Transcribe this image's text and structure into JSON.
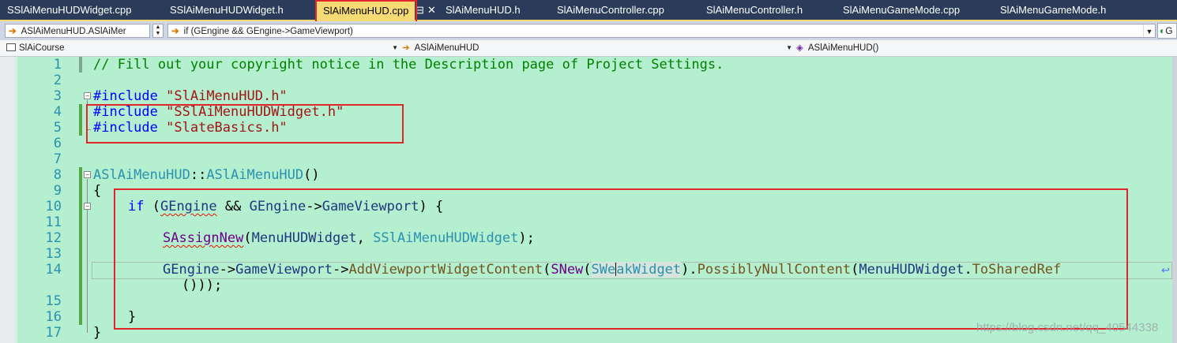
{
  "tabs": [
    {
      "label": "SSlAiMenuHUDWidget.cpp",
      "active": false
    },
    {
      "label": "SSlAiMenuHUDWidget.h",
      "active": false
    },
    {
      "label": "SlAiMenuHUD.cpp",
      "active": true,
      "pin": "⊟",
      "close": "✕"
    },
    {
      "label": "SlAiMenuHUD.h",
      "active": false
    },
    {
      "label": "SlAiMenuController.cpp",
      "active": false
    },
    {
      "label": "SlAiMenuController.h",
      "active": false
    },
    {
      "label": "SlAiMenuGameMode.cpp",
      "active": false
    },
    {
      "label": "SlAiMenuGameMode.h",
      "active": false
    }
  ],
  "navbar": {
    "member_combo": "ASlAiMenuHUD.ASlAiMer",
    "statement_combo": "if (GEngine && GEngine->GameViewport)",
    "go_button": "G"
  },
  "scopebar": {
    "project": "SlAiCourse",
    "class": "ASlAiMenuHUD",
    "function": "ASlAiMenuHUD()"
  },
  "editor": {
    "line_numbers": [
      "1",
      "2",
      "3",
      "4",
      "5",
      "6",
      "7",
      "8",
      "9",
      "10",
      "11",
      "12",
      "13",
      "14",
      "",
      "15",
      "16",
      "17"
    ],
    "comment_line": "// Fill out your copyright notice in the Description page of Project Settings.",
    "include_kw": "#include",
    "include_1": "\"SlAiMenuHUD.h\"",
    "include_2": "\"SSlAiMenuHUDWidget.h\"",
    "include_3": "\"SlateBasics.h\"",
    "ctor_class": "ASlAiMenuHUD",
    "ctor_sep": "::",
    "ctor_name": "ASlAiMenuHUD",
    "ctor_parens": "()",
    "brace_open": "{",
    "brace_close": "}",
    "if_kw": "if",
    "if_open": " (",
    "gengine": "GEngine",
    "and_op": " && ",
    "arrow": "->",
    "game_viewport": "GameViewport",
    "if_close": ") {",
    "sassign": "SAssignNew",
    "paren_open": "(",
    "menu_widget_var": "MenuHUDWidget",
    "comma_sep": ", ",
    "widget_type": "SSlAiMenuHUDWidget",
    "stmt_end": ");",
    "add_content": "AddViewportWidgetContent",
    "snew": "SNew",
    "weak_1": "SWe",
    "weak_2": "akWidget",
    "paren_close": ")",
    "dot": ".",
    "possibly_null": "PossiblyNullContent",
    "to_shared": "ToSharedRef",
    "wrap_tail": "()));",
    "inner_close": "}"
  },
  "watermark": "https://blog.csdn.net/qq_40544338",
  "colors": {
    "tab_bar": "#2b3c5a",
    "active_tab": "#f6db74",
    "editor_bg": "#b4efcf",
    "annotation_red": "#e0262c"
  }
}
